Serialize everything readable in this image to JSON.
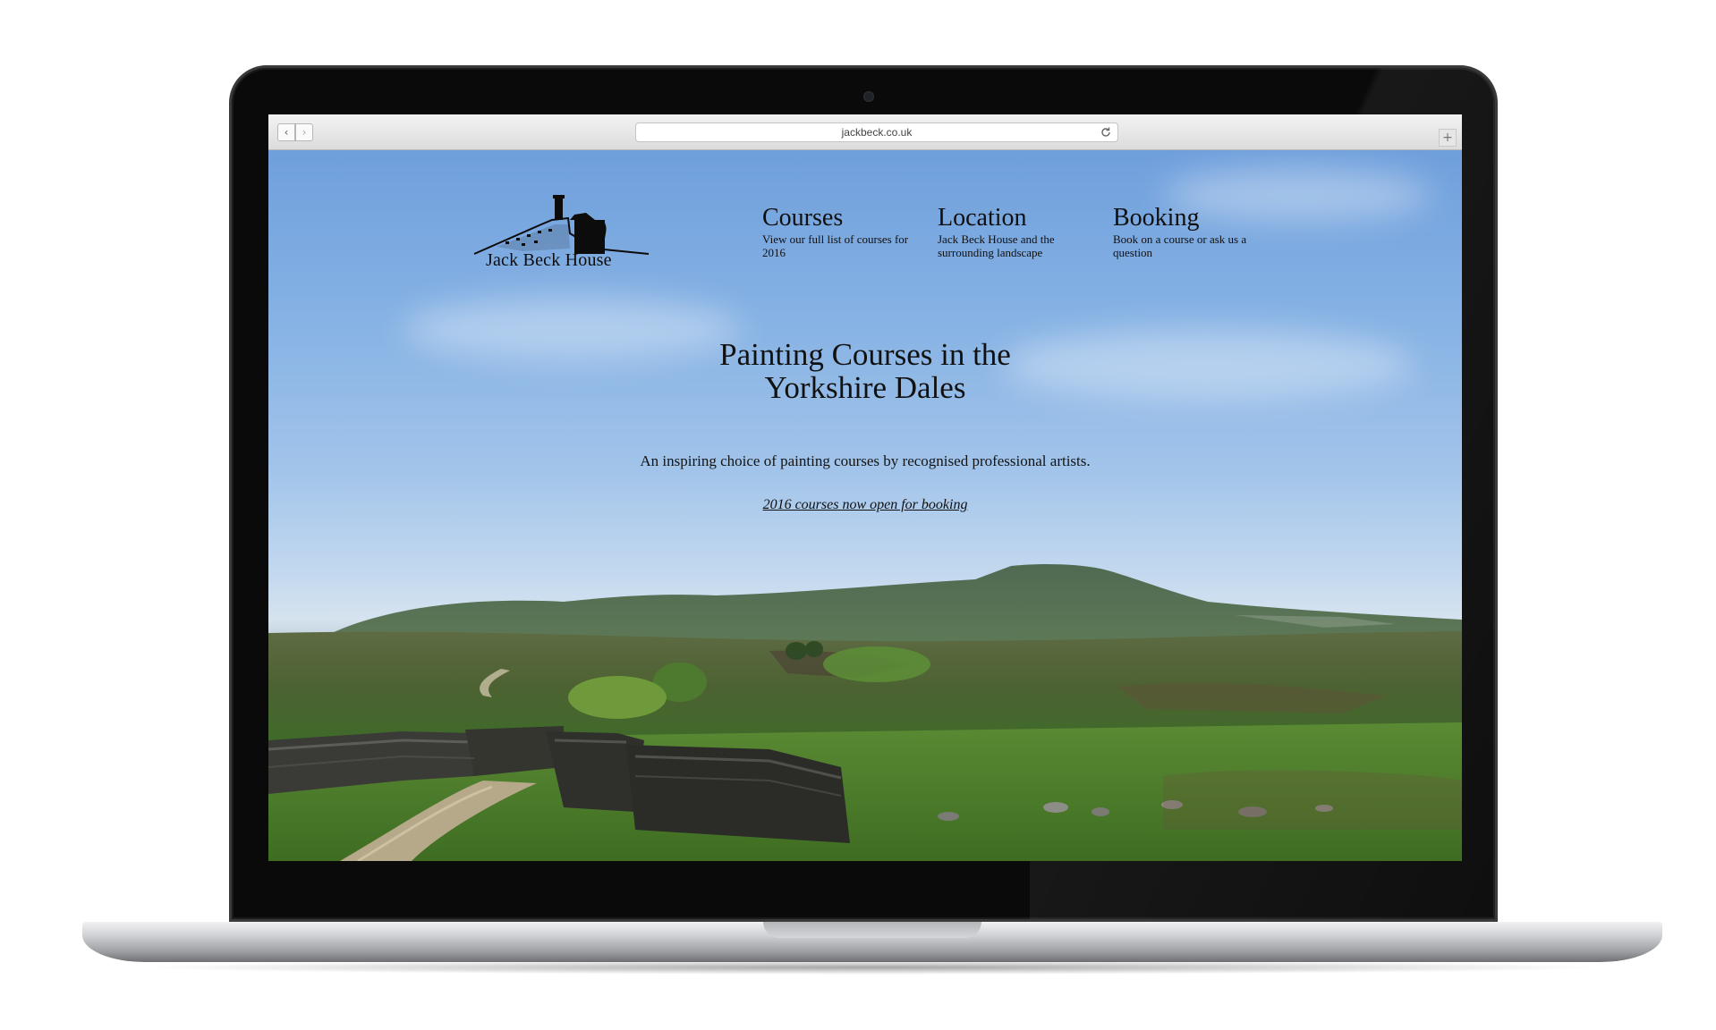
{
  "browser": {
    "url": "jackbeck.co.uk",
    "back_label": "‹",
    "forward_label": "›",
    "new_tab_label": "+"
  },
  "site": {
    "logo_text": "Jack Beck House",
    "nav": [
      {
        "title": "Courses",
        "description": "View our full list of courses for 2016"
      },
      {
        "title": "Location",
        "description": "Jack Beck House and the surrounding landscape"
      },
      {
        "title": "Booking",
        "description": "Book on a course or ask us a question"
      }
    ],
    "hero": {
      "title_line1": "Painting Courses in the",
      "title_line2": "Yorkshire Dales",
      "subtitle": "An inspiring choice of painting courses by recognised professional artists.",
      "link_text": "2016 courses now open for booking"
    }
  }
}
